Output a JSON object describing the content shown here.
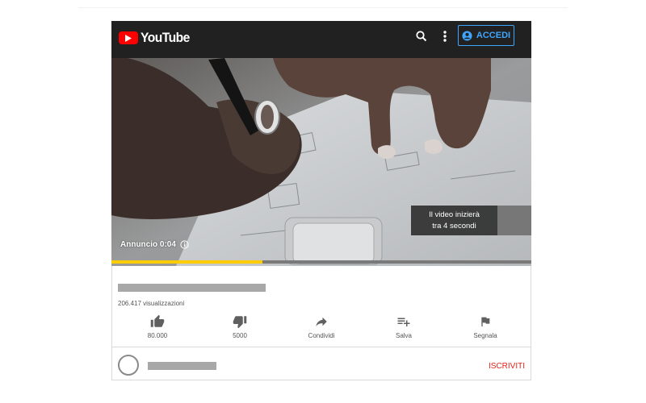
{
  "header": {
    "brand": "YouTube",
    "signin_label": "ACCEDI",
    "colors": {
      "bar": "#212121",
      "logo": "#ff0000",
      "accent": "#3ea6ff"
    }
  },
  "player": {
    "ad_label": "Annuncio 0:04",
    "skip_line1": "Il video inizierà",
    "skip_line2": "tra 4 secondi",
    "ad_progress": 0.36,
    "progress_color": "#ffcc00"
  },
  "info": {
    "views": "206.417 visualizzazioni",
    "actions": [
      {
        "icon": "thumb-up-icon",
        "label": "80.000"
      },
      {
        "icon": "thumb-down-icon",
        "label": "5000"
      },
      {
        "icon": "share-icon",
        "label": "Condividi"
      },
      {
        "icon": "playlist-add-icon",
        "label": "Salva"
      },
      {
        "icon": "flag-icon",
        "label": "Segnala"
      }
    ],
    "subscribe_label": "ISCRIVITI",
    "subscribe_color": "#e62117"
  }
}
